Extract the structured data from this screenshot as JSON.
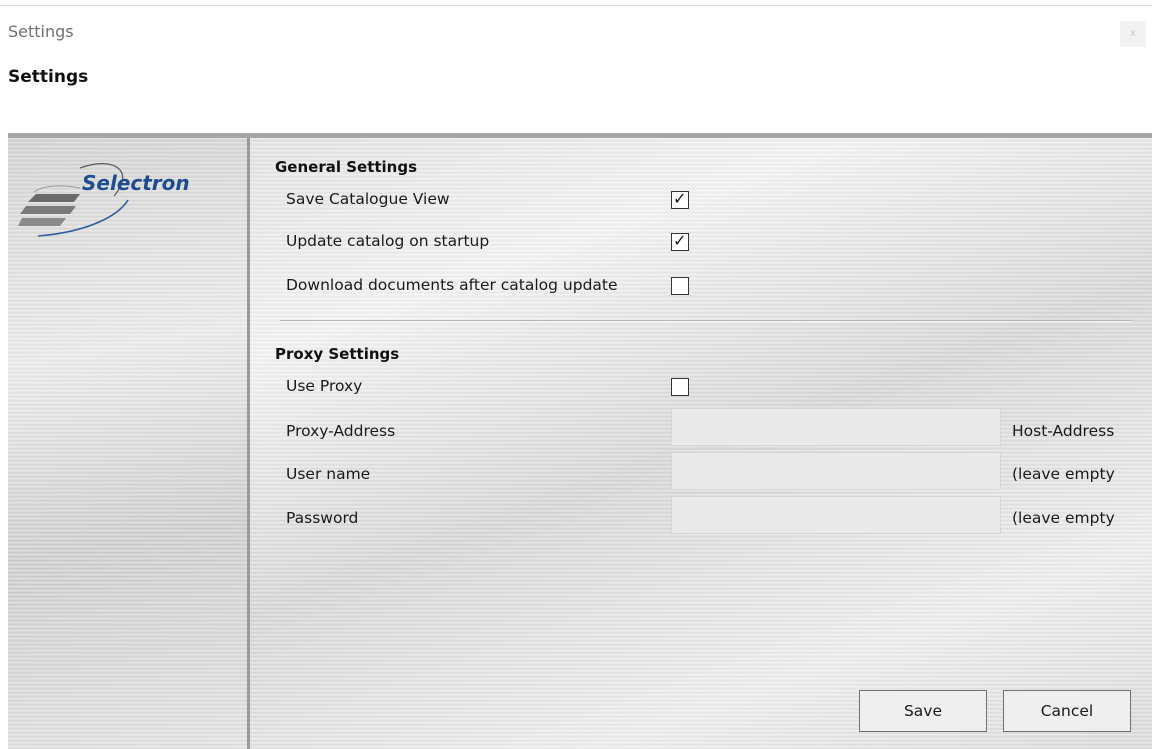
{
  "window": {
    "title": "Settings",
    "close_label": "x"
  },
  "page": {
    "title": "Settings"
  },
  "brand": {
    "logo_text": "Selectron",
    "logo_color": "#1f4c8f"
  },
  "general": {
    "title": "General Settings",
    "items": [
      {
        "label": "Save Catalogue View",
        "checked": true
      },
      {
        "label": "Update catalog on startup",
        "checked": true
      },
      {
        "label": "Download documents after catalog update",
        "checked": false
      }
    ]
  },
  "proxy": {
    "title": "Proxy Settings",
    "use_proxy": {
      "label": "Use Proxy",
      "checked": false
    },
    "fields": [
      {
        "label": "Proxy-Address",
        "value": "",
        "hint": "Host-Address"
      },
      {
        "label": "User name",
        "value": "",
        "hint": "(leave empty"
      },
      {
        "label": "Password",
        "value": "",
        "hint": "(leave empty"
      }
    ]
  },
  "actions": {
    "save_label": "Save",
    "cancel_label": "Cancel"
  },
  "icons": {
    "check": "✓"
  }
}
